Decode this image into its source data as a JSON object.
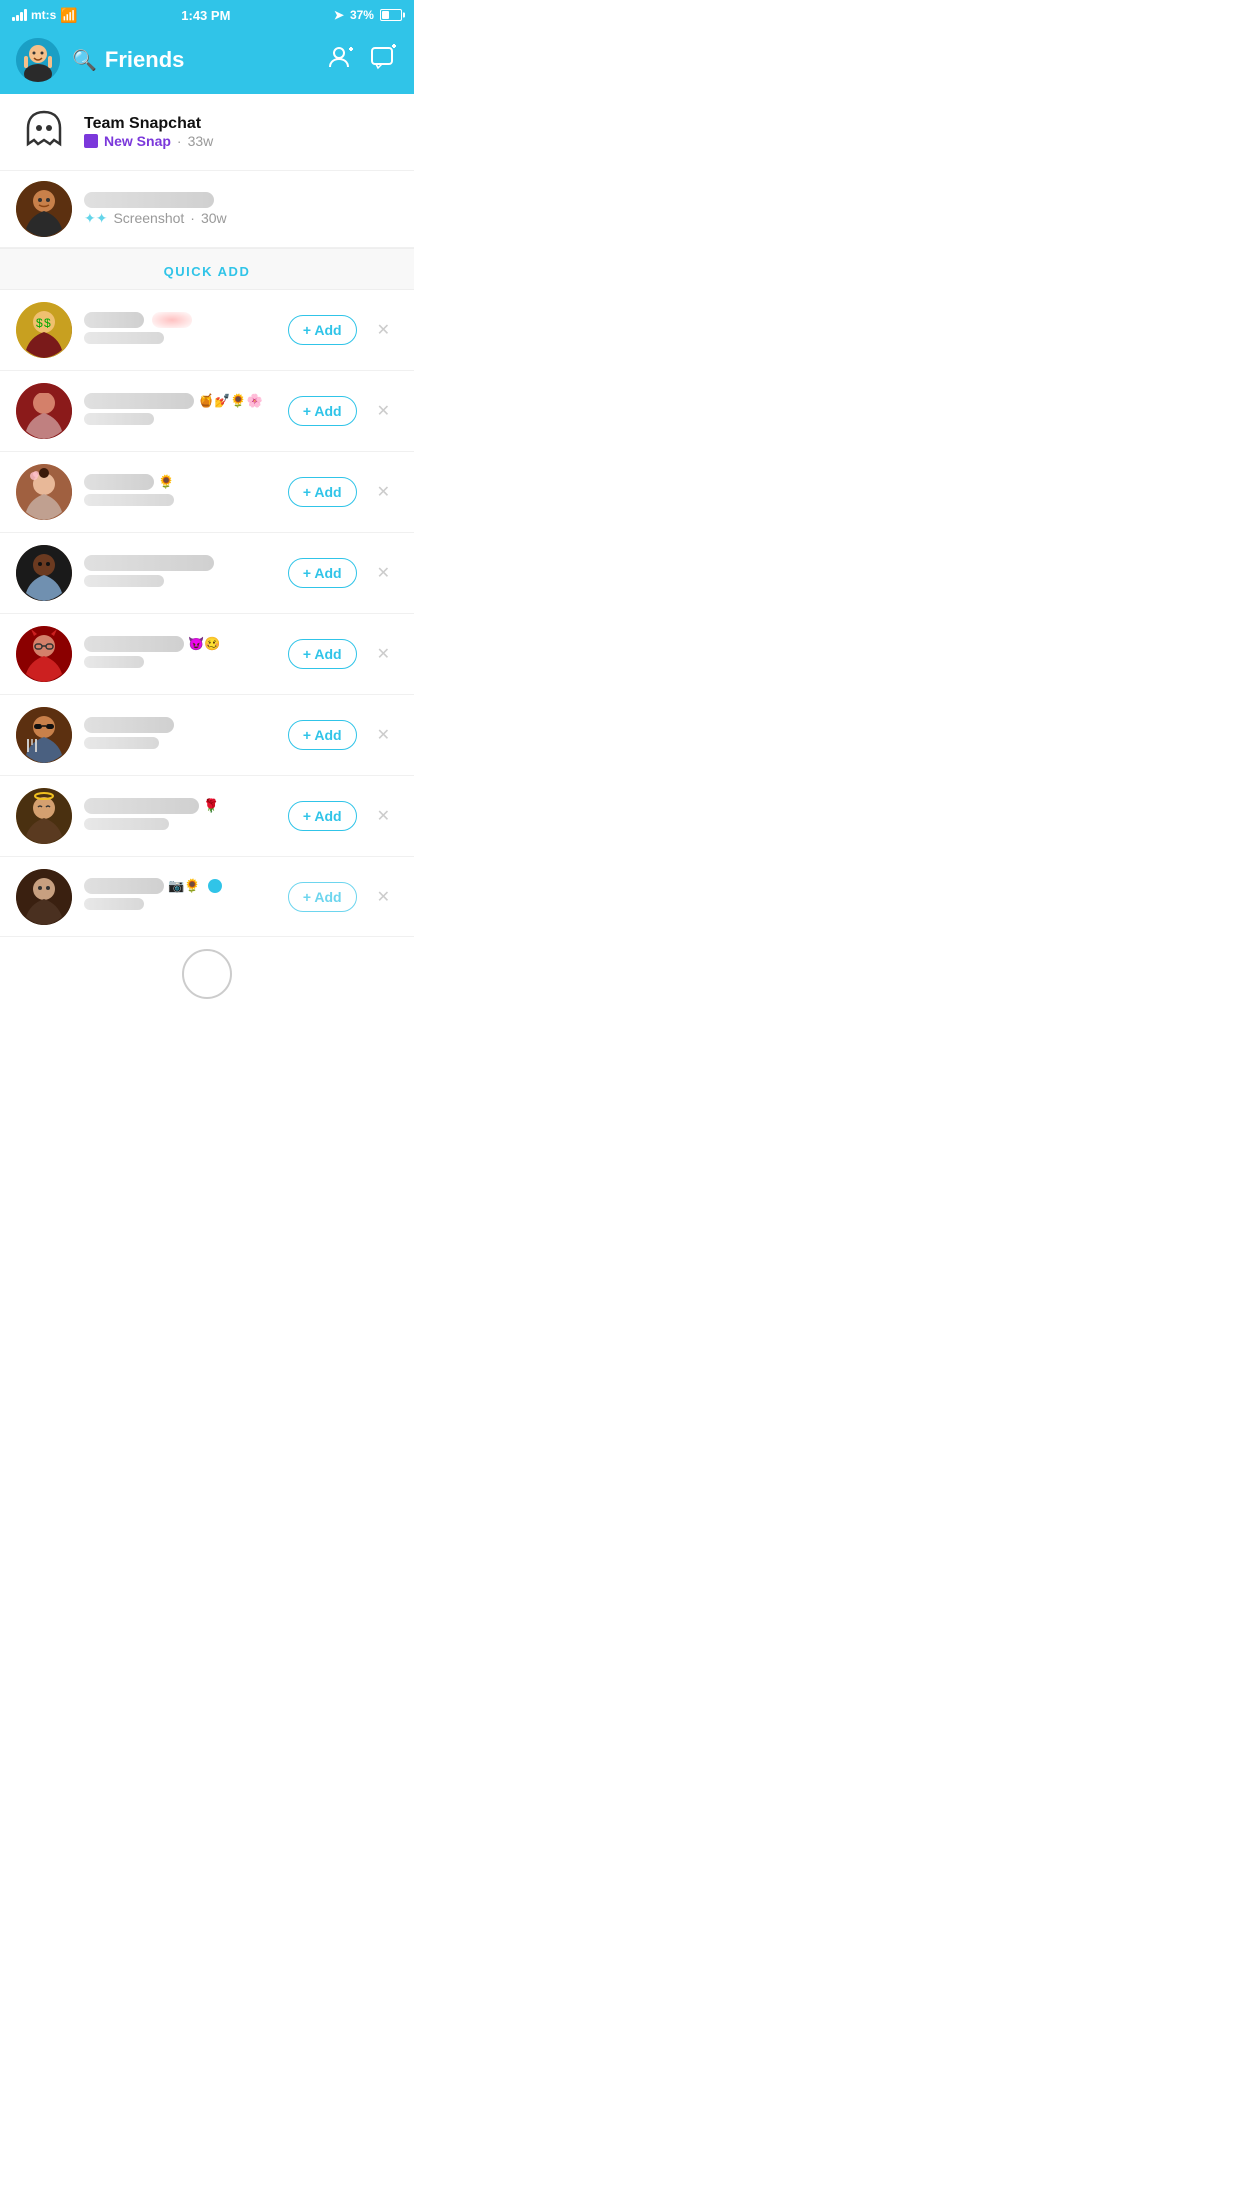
{
  "statusBar": {
    "carrier": "mt:s",
    "wifi": true,
    "time": "1:43 PM",
    "location": true,
    "battery": "37%"
  },
  "header": {
    "title": "Friends",
    "addFriendLabel": "+ Add Friend",
    "addChatLabel": "+ Add Chat"
  },
  "teamSnapchat": {
    "name": "Team Snapchat",
    "snapStatus": "New Snap",
    "timestamp": "33w",
    "snapColor": "#7B38DB"
  },
  "friend1": {
    "name": "[blurred]",
    "subStatus": "Screenshot",
    "timestamp": "30w"
  },
  "quickAdd": {
    "label": "QUICK ADD"
  },
  "quickAddItems": [
    {
      "id": 1,
      "nameBlurred": true,
      "nameWidth": 100,
      "emojis": "",
      "subBlurred": true,
      "subWidth": 80,
      "addLabel": "+ Add",
      "blurStyle": "red"
    },
    {
      "id": 2,
      "nameBlurred": true,
      "nameWidth": 110,
      "emojis": "🍯💅🌻🌸",
      "subBlurred": true,
      "subWidth": 70,
      "addLabel": "+ Add"
    },
    {
      "id": 3,
      "nameBlurred": true,
      "nameWidth": 70,
      "emojis": "🌻",
      "subBlurred": true,
      "subWidth": 90,
      "addLabel": "+ Add"
    },
    {
      "id": 4,
      "nameBlurred": true,
      "nameWidth": 130,
      "emojis": "",
      "subBlurred": true,
      "subWidth": 80,
      "addLabel": "+ Add"
    },
    {
      "id": 5,
      "nameBlurred": true,
      "nameWidth": 100,
      "emojis": "😈🥴",
      "subBlurred": true,
      "subWidth": 60,
      "addLabel": "+ Add"
    },
    {
      "id": 6,
      "nameBlurred": true,
      "nameWidth": 90,
      "emojis": "",
      "subBlurred": true,
      "subWidth": 75,
      "addLabel": "+ Add"
    },
    {
      "id": 7,
      "nameBlurred": true,
      "nameWidth": 115,
      "emojis": "🌹",
      "subBlurred": true,
      "subWidth": 85,
      "addLabel": "+ Add"
    },
    {
      "id": 8,
      "nameBlurred": true,
      "nameWidth": 80,
      "emojis": "📷🌻",
      "subBlurred": true,
      "subWidth": 60,
      "addLabel": "+ Add",
      "partial": true
    }
  ]
}
